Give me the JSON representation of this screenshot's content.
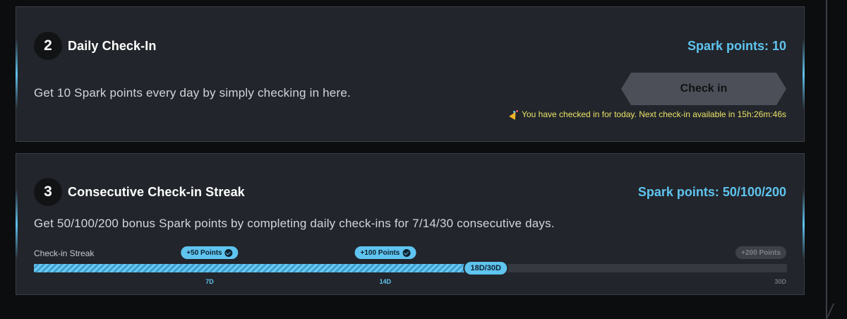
{
  "daily_checkin": {
    "step": "2",
    "title": "Daily Check-In",
    "points": "Spark points: 10",
    "description": "Get 10 Spark points every day by simply checking in here.",
    "button_label": "Check in",
    "notice_icon": "party-popper-icon",
    "notice": "You have checked in for today. Next check-in available in 15h:26m:46s"
  },
  "streak": {
    "step": "3",
    "title": "Consecutive Check-in Streak",
    "points": "Spark points: 50/100/200",
    "description": "Get 50/100/200 bonus Spark points by completing daily check-ins for 7/14/30 consecutive days.",
    "bar_label": "Check-in Streak",
    "current_days": 18,
    "total_days": 30,
    "progress_label": "18D/30D",
    "milestones": [
      {
        "day": 7,
        "tick_label": "7D",
        "reward": "+50 Points",
        "achieved": true
      },
      {
        "day": 14,
        "tick_label": "14D",
        "reward": "+100 Points",
        "achieved": true
      },
      {
        "day": 30,
        "tick_label": "30D",
        "reward": "+200 Points",
        "achieved": false
      }
    ]
  },
  "colors": {
    "accent": "#5fc4ef",
    "card_bg": "#22252b",
    "notice": "#e9e36a",
    "button_bg": "#4c4f57"
  }
}
